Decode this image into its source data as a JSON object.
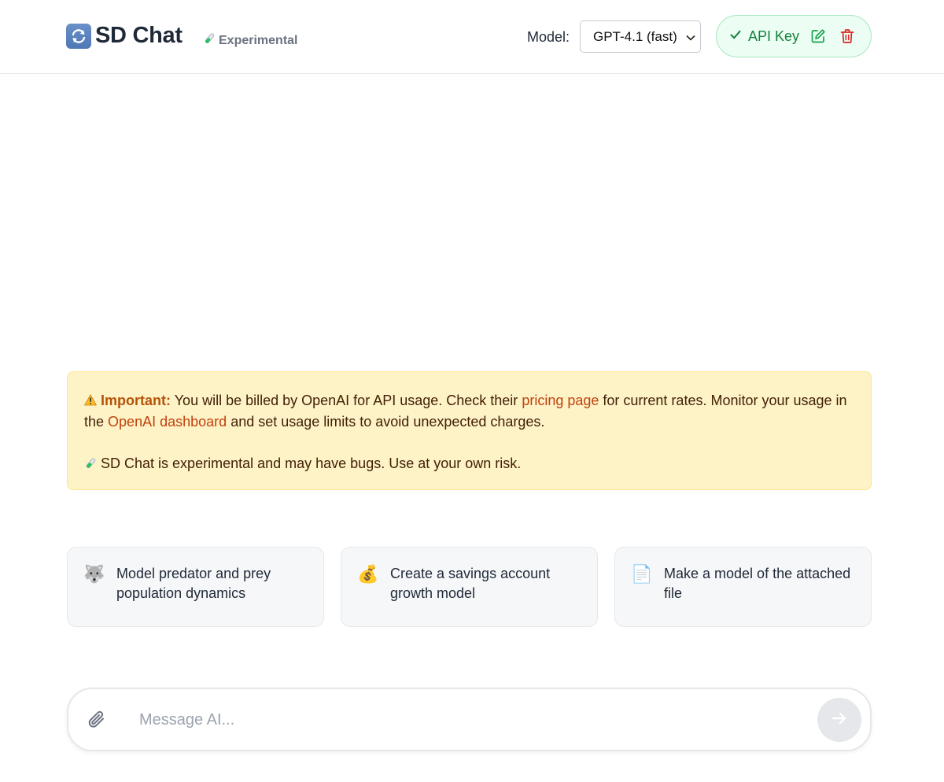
{
  "header": {
    "app_title": "SD Chat",
    "badge_label": "Experimental",
    "model_label": "Model:",
    "model_selected": "GPT-4.1 (fast)",
    "api_key_label": "API Key"
  },
  "warning": {
    "important_label": "Important:",
    "text_part1": "You will be billed by OpenAI for API usage. Check their",
    "pricing_link": "pricing page",
    "text_part2": "for current rates. Monitor your usage in the",
    "dashboard_link": "OpenAI dashboard",
    "text_part3": "and set usage limits to avoid unexpected charges.",
    "experimental_note": "SD Chat is experimental and may have bugs. Use at your own risk."
  },
  "suggestions": [
    {
      "icon": "wolf-icon",
      "emoji": "🐺",
      "label": "Model predator and prey population dynamics"
    },
    {
      "icon": "money-bag-icon",
      "emoji": "💰",
      "label": "Create a savings account growth model"
    },
    {
      "icon": "document-icon",
      "emoji": "📄",
      "label": "Make a model of the attached file"
    }
  ],
  "composer": {
    "placeholder": "Message AI...",
    "value": ""
  },
  "colors": {
    "accent_green": "#15803d",
    "delete_red": "#dc2626",
    "warning_bg": "#fef3c7",
    "link_orange": "#c2410c"
  }
}
